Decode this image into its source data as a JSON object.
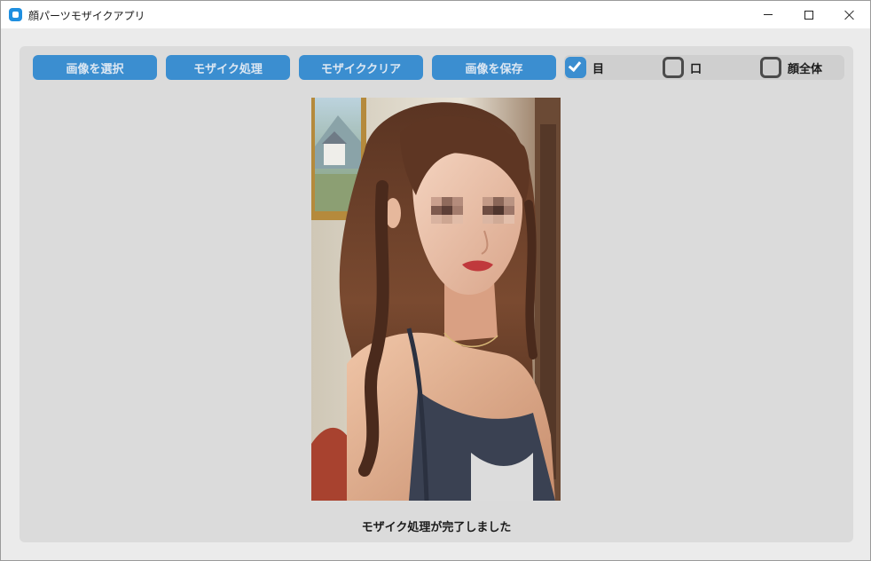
{
  "window": {
    "title": "顔パーツモザイクアプリ"
  },
  "toolbar": {
    "select_image": "画像を選択",
    "mosaic_process": "モザイク処理",
    "mosaic_clear": "モザイククリア",
    "save_image": "画像を保存"
  },
  "options": [
    {
      "label": "目",
      "checked": true
    },
    {
      "label": "口",
      "checked": false
    },
    {
      "label": "顔全体",
      "checked": false
    }
  ],
  "status": {
    "message": "モザイク処理が完了しました"
  },
  "colors": {
    "accent": "#3b8ed0",
    "frame": "#dbdbdb",
    "window_bg": "#ebebeb"
  },
  "icons": [
    "app-icon",
    "minimize-icon",
    "maximize-icon",
    "close-icon",
    "checkmark-icon"
  ]
}
